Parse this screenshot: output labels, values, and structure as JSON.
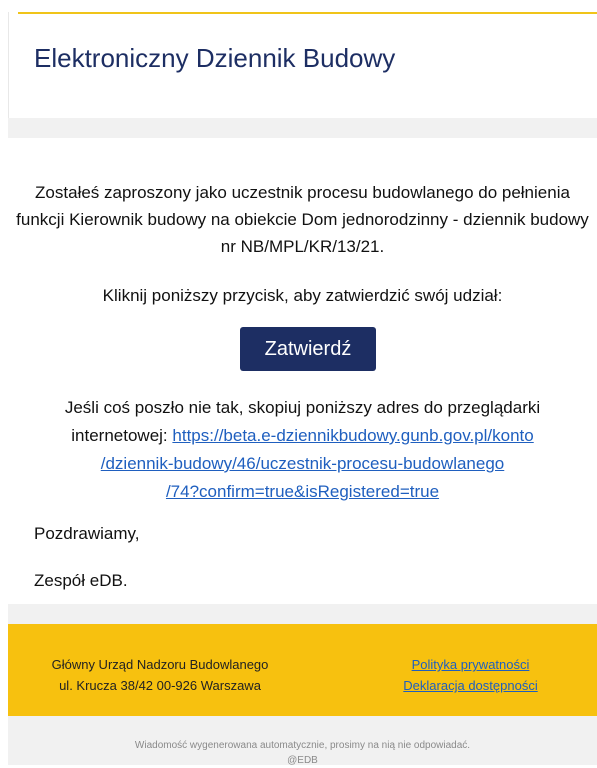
{
  "header": {
    "title": "Elektroniczny Dziennik Budowy"
  },
  "message": {
    "intro": "Zostałeś zaproszony jako uczestnik procesu budowlanego do pełnienia funkcji Kierownik budowy na obiekcie Dom jednorodzinny - dziennik budowy nr NB/MPL/KR/13/21.",
    "prompt": "Kliknij poniższy przycisk, aby zatwierdzić swój udział:",
    "confirm_label": "Zatwierdź",
    "fallback_text": "Jeśli coś poszło nie tak, skopiuj poniższy adres do przeglądarki internetowej:",
    "link_part1": "https://beta.e-dziennikbudowy.gunb.gov.pl/konto",
    "link_part2": "/dziennik-budowy/46/uczestnik-procesu-budowlanego",
    "link_part3": "/74?confirm=true&isRegistered=true",
    "greeting": "Pozdrawiamy,",
    "team": "Zespół eDB."
  },
  "footer": {
    "address_line1": "Główny Urząd Nadzoru Budowlanego",
    "address_line2": "ul. Krucza 38/42 00-926 Warszawa",
    "privacy_link": "Polityka prywatności",
    "accessibility_link": "Deklaracja dostępności"
  },
  "notice": {
    "auto_message": "Wiadomość wygenerowana automatycznie, prosimy na nią nie odpowiadać.",
    "copyright": "@EDB"
  },
  "colors": {
    "accent": "#f7c10f",
    "brand": "#1d2e63",
    "link": "#1f5fbf"
  }
}
